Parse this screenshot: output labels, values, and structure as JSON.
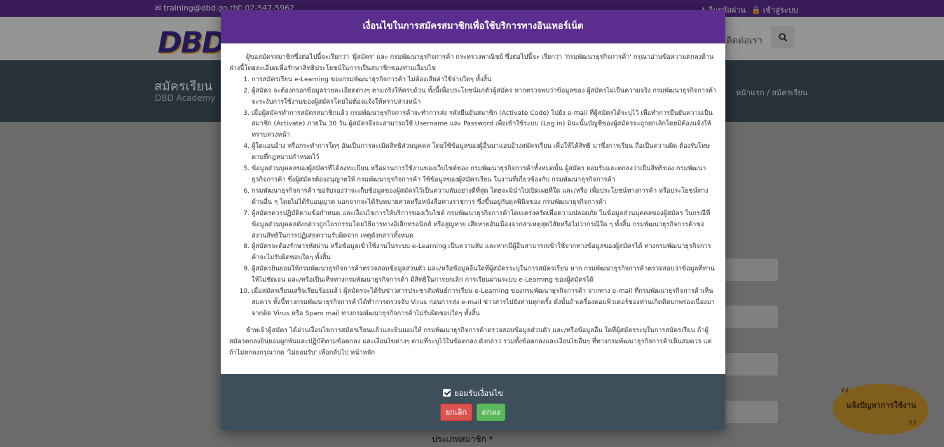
{
  "topbar": {
    "email": "training@dbd.go.th",
    "phone": "02-547-5962",
    "forgot_password": "ลืมรหัสผ่าน",
    "login": "เข้าสู่ระบบ"
  },
  "header": {
    "logo_text": "DBD",
    "nav_contact": "ติดต่อเรา"
  },
  "hero": {
    "title": "สมัครเรียน",
    "subtitle": "DBD Academy",
    "breadcrumb_home": "หน้าแรก",
    "breadcrumb_sep": "/",
    "breadcrumb_current": "สมัครเรียน"
  },
  "form": {
    "member_type_label": "ประเภทสมาชิก",
    "required_mark": "*"
  },
  "help": {
    "label": "แจ้งปัญหาการใช้งาน"
  },
  "modal": {
    "title": "เงื่อนไขในการสมัครสมาชิกเพื่อใช้บริการทางอินเทอร์เน็ต",
    "intro": "ผู้ขอสมัครสมาชิกซึ่งต่อไปนี้จะเรียกว่า 'ผู้สมัคร' และ กรมพัฒนาธุรกิจการค้า กระทรวงพาณิชย์ ซึ่งต่อไปนี้จะ เรียกว่า 'กรมพัฒนาธุรกิจการค้า' กรุณาอ่านข้อความตกลงด้านล่างนี้โดยละเอียดเพื่อรักษาสิทธิประโยชน์ในการเป็นสมาชิกของท่านเงื่อนไข",
    "terms": [
      "การสมัครเรียน e-Learning ของกรมพัฒนาธุรกิจการค้า ไม่ต้องเสียค่าใช้จ่ายใดๆ ทั้งสิ้น",
      "ผู้สมัคร จะต้องกรอกข้อมูลรายละเอียดต่างๆ ตามจริงให้ครบถ้วน ทั้งนี้เพื่อประโยชน์แก่ตัวผู้สมัคร หากตรวจพบว่าข้อมูลของ ผู้สมัครไม่เป็นความจริง กรมพัฒนาธุรกิจการค้าจะระงับการใช้งานของผู้สมัครโดยไม่ต้องแจ้งให้ทราบล่วงหน้า",
      "เมื่อผู้สมัครทำการสมัครสมาชิกแล้ว กรมพัฒนาธุรกิจการค้าจะทำการส่ง รหัสยืนยันสมาชิก (Activate Code) ไปยัง e-mail ที่ผู้สมัครได้ระบุไว้ เพื่อทำการยืนยันความเป็นสมาชิก (Activate) ภายใน 30 วัน ผู้สมัครจึงจะสามารถใช้ Username และ Password เพื่อเข้าใช้ระบบ (Log in) มิฉะนั้นบัญชีของผู้สมัครจะถูกยกเลิกโดยมิต้องแจ้งให้ ทราบล่วงหน้า",
      "ผู้ใดแอบอ้าง หรือกระทำการใดๆ อันเป็นการละเมิดสิทธิส่วนบุคคล โดยใช้ข้อมูลของผู้อื่นมาแอบอ้างสมัครเรียน เพื่อให้ได้สิทธิ มาซึ่งการเรียน ถือเป็นความผิด ต้องรับโทษตามที่กฎหมายกำหนดไว้",
      "ข้อมูลส่วนบุคคลของผู้สมัครที่ได้ลงทะเบียน หรือผ่านการใช้งานของเว็บไซต์ของ กรมพัฒนาธุรกิจการค้าทั้งหมดนั้น ผู้สมัคร ยอมรับและตกลงว่าเป็นสิทธิของ กรมพัฒนาธุรกิจการค้า ซึ่งผู้สมัครต้องอนุญาตให้ กรมพัฒนาธุรกิจการค้า ใช้ข้อมูลของผู้สมัครเรียน ในงานที่เกี่ยวข้องกับ กรมพัฒนาธุรกิจการค้า",
      "กรมพัฒนาธุรกิจการค้า ขอรับรองว่าจะเก็บข้อมูลของผู้สมัครไว้เป็นความลับอย่างดีที่สุด โดยจะมินำไปเปิดเผยที่ใด และ/หรือ เพื่อประโยชน์ทางการค้า หรือประโยชน์ทางด้านอื่น ๆ โดยไม่ได้รับอนุญาต นอกจากจะได้รับหมายศาลหรือหนังสือทางราชการ ซึ่งขึ้นอยู่กับดุลพินิจของ กรมพัฒนาธุรกิจการค้า",
      "ผู้สมัครควรปฏิบัติตามข้อกำหนด และเงื่อนไขการให้บริการของเว็บไซต์ กรมพัฒนาธุรกิจการค้าโดยเคร่งครัดเพื่อความปลอดภัย ในข้อมูลส่วนบุคคลของผู้สมัคร ในกรณีที่ข้อมูลส่วนบุคคลดังกล่าวถูกโจรกรรมโดยวิธีการทางอิเล็กทรอนิกส์ หรือสูญหาย เสียหายอันเนื่องจากสาเหตุสุดวิสัยหรือไม่ว่ากรณีใด ๆ ทั้งสิ้น กรมพัฒนาธุรกิจการค้าขอสงวนสิทธิในการปฏิเสธความรับผิดจาก เหตุดังกล่าวทั้งหมด",
      "ผู้สมัครจะต้องรักษารหัสผ่าน หรือข้อมูลเข้าใช้งานในระบบ e-Learning เป็นความลับ และหากมีผู้อื่นสามารถเข้าใช้จากทางข้อมูลของผู้สมัครได้ ทางกรมพัฒนาธุรกิจการค้าจะไม่รับผิดชอบใดๆ ทั้งสิ้น",
      "ผู้สมัครยินยอมให้กรมพัฒนาธุรกิจการค้าตรวจสอบข้อมูลส่วนตัว และ/หรือข้อมูลอื่นใดที่ผู้สมัครระบุในการสมัครเรียน หาก กรมพัฒนาธุรกิจการค้าตรวจสอบว่าข้อมูลที่ท่านให้ไม่ชัดเจน และ/หรือเป็นเท็จทางกรมพัฒนาธุรกิจการค้า มีสิทธิในการยกเลิก การเรียนผ่านระบบ e-Learning ของผู้สมัครได้",
      "เมื่อสมัครเรียนเสร็จเรียบร้อยแล้ว ผู้สมัครจะได้รับข่าวสารประชาสัมพันธ์การเรียน e-Learning ของกรมพัฒนาธุรกิจการค้า จากทาง e-mail ที่กรมพัฒนาธุรกิจการค้าเห็นสมควร ทั้งนี้ทางกรมพัฒนาธุรกิจการค้าได้ทำการตรวจจับ Virus ก่อนการส่ง e-mail ข่าวสารไปยังท่านทุกครั้ง ดังนั้นถ้าเครื่องคอมพิวเตอร์ของท่านเกิดติดบกพร่องเนื่องมาจากติด Virus หรือ Spam mail ทางกรมพัฒนาธุรกิจการค้าไม่รับผิดชอบใดๆ ทั้งสิ้น"
    ],
    "outro": "ข้าพเจ้าผู้สมัคร ได้อ่านเงื่อนไขการสมัครเรียนแล้วและยินยอมให้ กรมพัฒนาธุรกิจการค้าตรวจสอบข้อมูลส่วนตัว และ/หรือข้อมูลอื่น ใดที่ผู้สมัครระบุในการสมัครเรียน ถ้าผู้สมัครตกลงยินยอมผูกพันและปฏิบัติตามข้อตกลง และเงื่อนไขต่างๆ ตามที่ระบุไว้ในข้อตกลง ดังกล่าว รวมทั้งข้อตกลงและเงื่อนไขอื่นๆ ที่ทางกรมพัฒนาธุรกิจการค้าเห็นสมควร แต่ถ้าไม่ตกลงกรุณากด 'ไม่ยอมรับ' เพื่อกลับไป หน้าหลัก",
    "agree_label": "ยอมรับเงื่อนไข",
    "cancel_label": "ยกเลิก",
    "ok_label": "ตกลง"
  }
}
